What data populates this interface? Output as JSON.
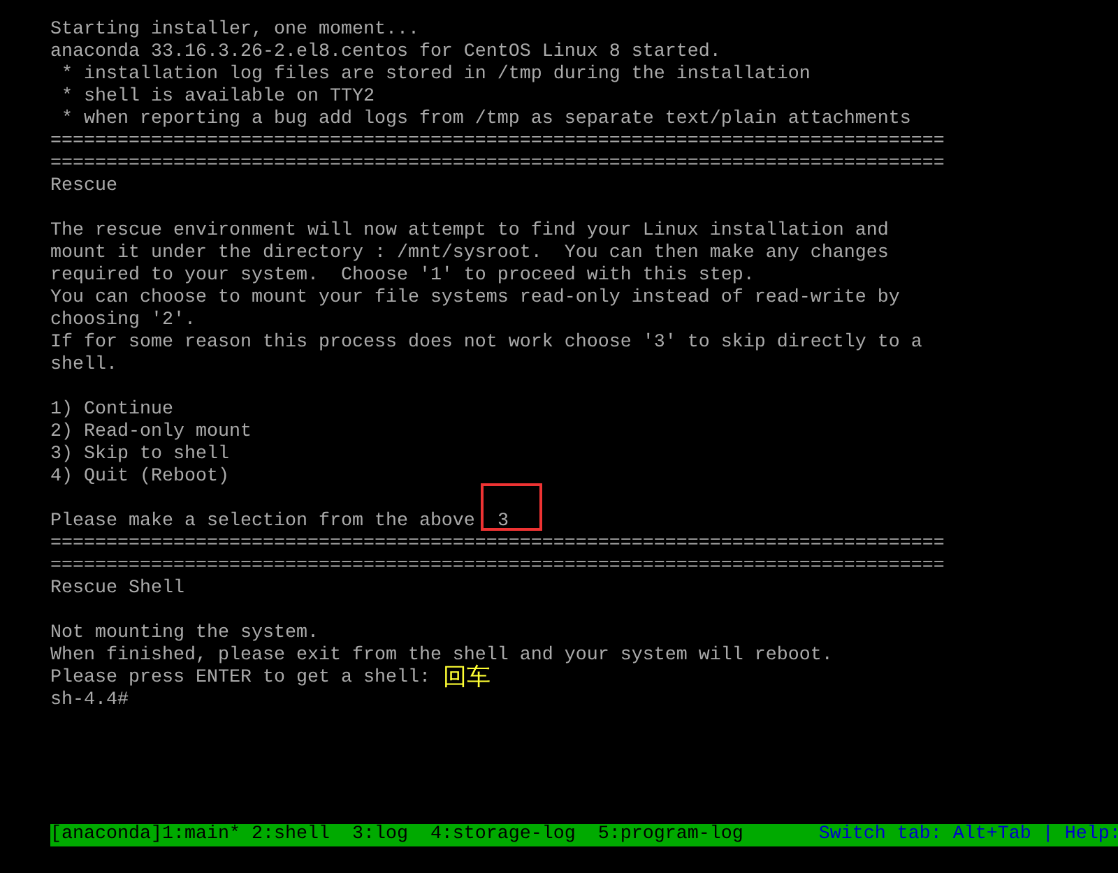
{
  "console": {
    "lines": [
      {
        "kind": "text",
        "text": "Starting installer, one moment..."
      },
      {
        "kind": "text",
        "text": "anaconda 33.16.3.26-2.el8.centos for CentOS Linux 8 started."
      },
      {
        "kind": "text",
        "text": " * installation log files are stored in /tmp during the installation"
      },
      {
        "kind": "text",
        "text": " * shell is available on TTY2"
      },
      {
        "kind": "text",
        "text": " * when reporting a bug add logs from /tmp as separate text/plain attachments"
      },
      {
        "kind": "text",
        "text": "================================================================================"
      },
      {
        "kind": "text",
        "text": "================================================================================"
      },
      {
        "kind": "text",
        "text": "Rescue"
      },
      {
        "kind": "blank"
      },
      {
        "kind": "text",
        "text": "The rescue environment will now attempt to find your Linux installation and"
      },
      {
        "kind": "text",
        "text": "mount it under the directory : /mnt/sysroot.  You can then make any changes"
      },
      {
        "kind": "text",
        "text": "required to your system.  Choose '1' to proceed with this step."
      },
      {
        "kind": "text",
        "text": "You can choose to mount your file systems read-only instead of read-write by"
      },
      {
        "kind": "text",
        "text": "choosing '2'."
      },
      {
        "kind": "text",
        "text": "If for some reason this process does not work choose '3' to skip directly to a"
      },
      {
        "kind": "text",
        "text": "shell."
      },
      {
        "kind": "blank"
      },
      {
        "kind": "text",
        "text": "1) Continue"
      },
      {
        "kind": "text",
        "text": "2) Read-only mount"
      },
      {
        "kind": "text",
        "text": "3) Skip to shell"
      },
      {
        "kind": "text",
        "text": "4) Quit (Reboot)"
      },
      {
        "kind": "blank"
      },
      {
        "kind": "prompt",
        "text": "Please make a selection from the above ",
        "input": "3",
        "marked": true
      },
      {
        "kind": "text",
        "text": "================================================================================"
      },
      {
        "kind": "text",
        "text": "================================================================================"
      },
      {
        "kind": "text",
        "text": "Rescue Shell"
      },
      {
        "kind": "blank"
      },
      {
        "kind": "text",
        "text": "Not mounting the system."
      },
      {
        "kind": "text",
        "text": "When finished, please exit from the shell and your system will reboot."
      },
      {
        "kind": "prompt",
        "text": "Please press ENTER to get a shell:",
        "note": "回车"
      },
      {
        "kind": "text",
        "text": "sh-4.4#"
      }
    ]
  },
  "status_bar": {
    "tabs": "[anaconda]1:main* 2:shell  3:log  4:storage-log  5:program-log",
    "hint": "Switch tab: Alt+Tab | Help:"
  }
}
